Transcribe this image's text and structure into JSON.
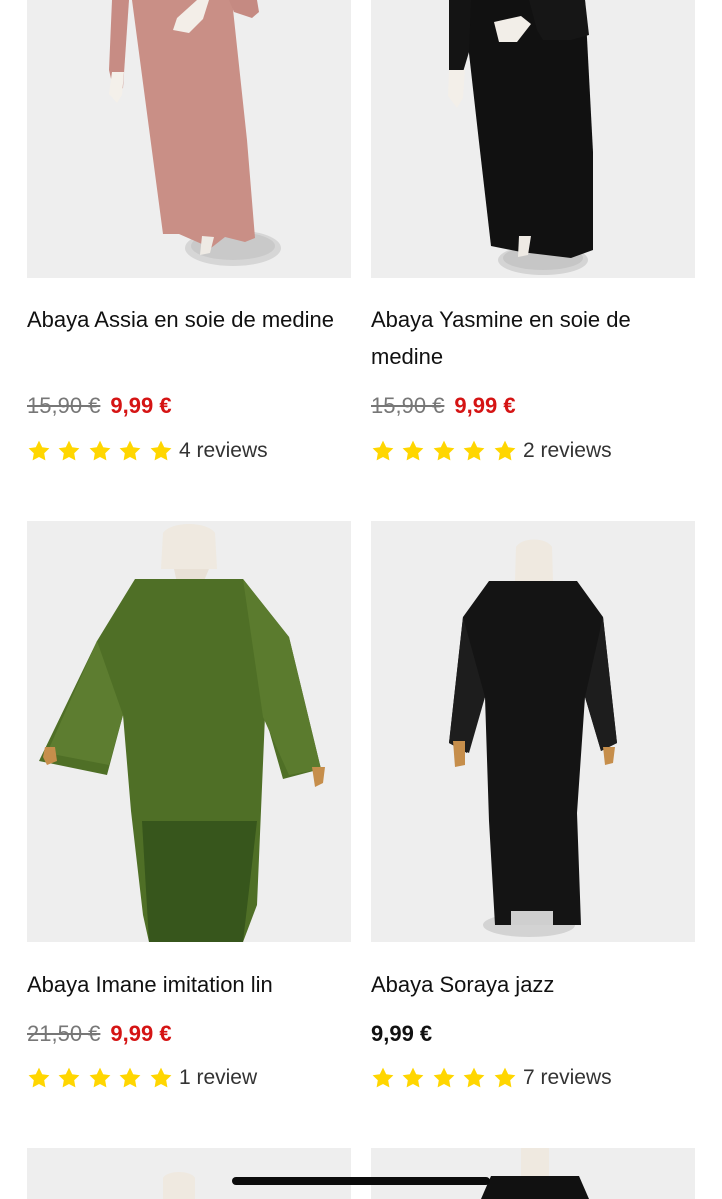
{
  "products": [
    {
      "title": "Abaya Assia en soie de medine",
      "old_price": "15,90 €",
      "price": "9,99 €",
      "reviews": "4 reviews",
      "rating": 5,
      "image_icon": "pink-abaya-image",
      "dress_color": "#c98f86"
    },
    {
      "title": "Abaya Yasmine en soie de medine",
      "old_price": "15,90 €",
      "price": "9,99 €",
      "reviews": "2 reviews",
      "rating": 5,
      "image_icon": "black-abaya-image",
      "dress_color": "#111111"
    },
    {
      "title": "Abaya Imane imitation lin",
      "old_price": "21,50 €",
      "price": "9,99 €",
      "reviews": "1 review",
      "rating": 5,
      "image_icon": "green-abaya-image",
      "dress_color": "#4f6f26"
    },
    {
      "title": "Abaya Soraya jazz",
      "old_price": "",
      "price": "9,99 €",
      "reviews": "7 reviews",
      "rating": 5,
      "image_icon": "black-abaya-image",
      "dress_color": "#141414"
    }
  ],
  "colors": {
    "sale": "#d51414",
    "star": "#ffd600",
    "old_price": "#777777",
    "image_background": "#eeeeee"
  }
}
